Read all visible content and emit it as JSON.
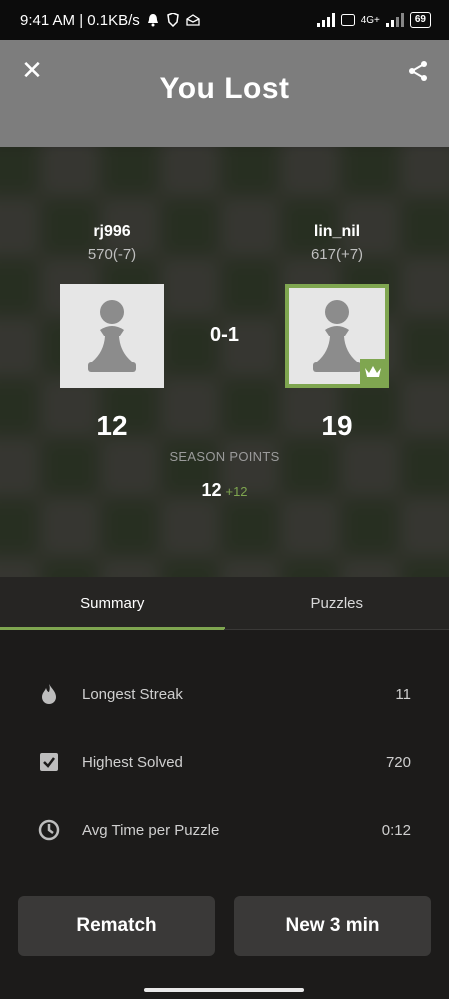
{
  "status_bar": {
    "time_speed": "9:41 AM | 0.1KB/s",
    "net_label": "4G+",
    "battery": "69"
  },
  "header": {
    "title": "You Lost"
  },
  "players": {
    "left": {
      "name": "rj996",
      "rating": "570(-7)",
      "points": "12"
    },
    "right": {
      "name": "lin_nil",
      "rating": "617(+7)",
      "points": "19"
    }
  },
  "result": "0-1",
  "season": {
    "label": "SEASON POINTS",
    "total": "12",
    "gain": "+12"
  },
  "tabs": [
    {
      "label": "Summary",
      "active": true
    },
    {
      "label": "Puzzles",
      "active": false
    }
  ],
  "summary": [
    {
      "icon": "flame-icon",
      "label": "Longest Streak",
      "value": "11"
    },
    {
      "icon": "checkbox-icon",
      "label": "Highest Solved",
      "value": "720"
    },
    {
      "icon": "clock-icon",
      "label": "Avg Time per Puzzle",
      "value": "0:12"
    }
  ],
  "buttons": {
    "rematch": "Rematch",
    "new_game": "New 3 min"
  },
  "colors": {
    "accent": "#7fa650",
    "header_bg": "#7d7d7d",
    "button_bg": "#3a3938"
  }
}
